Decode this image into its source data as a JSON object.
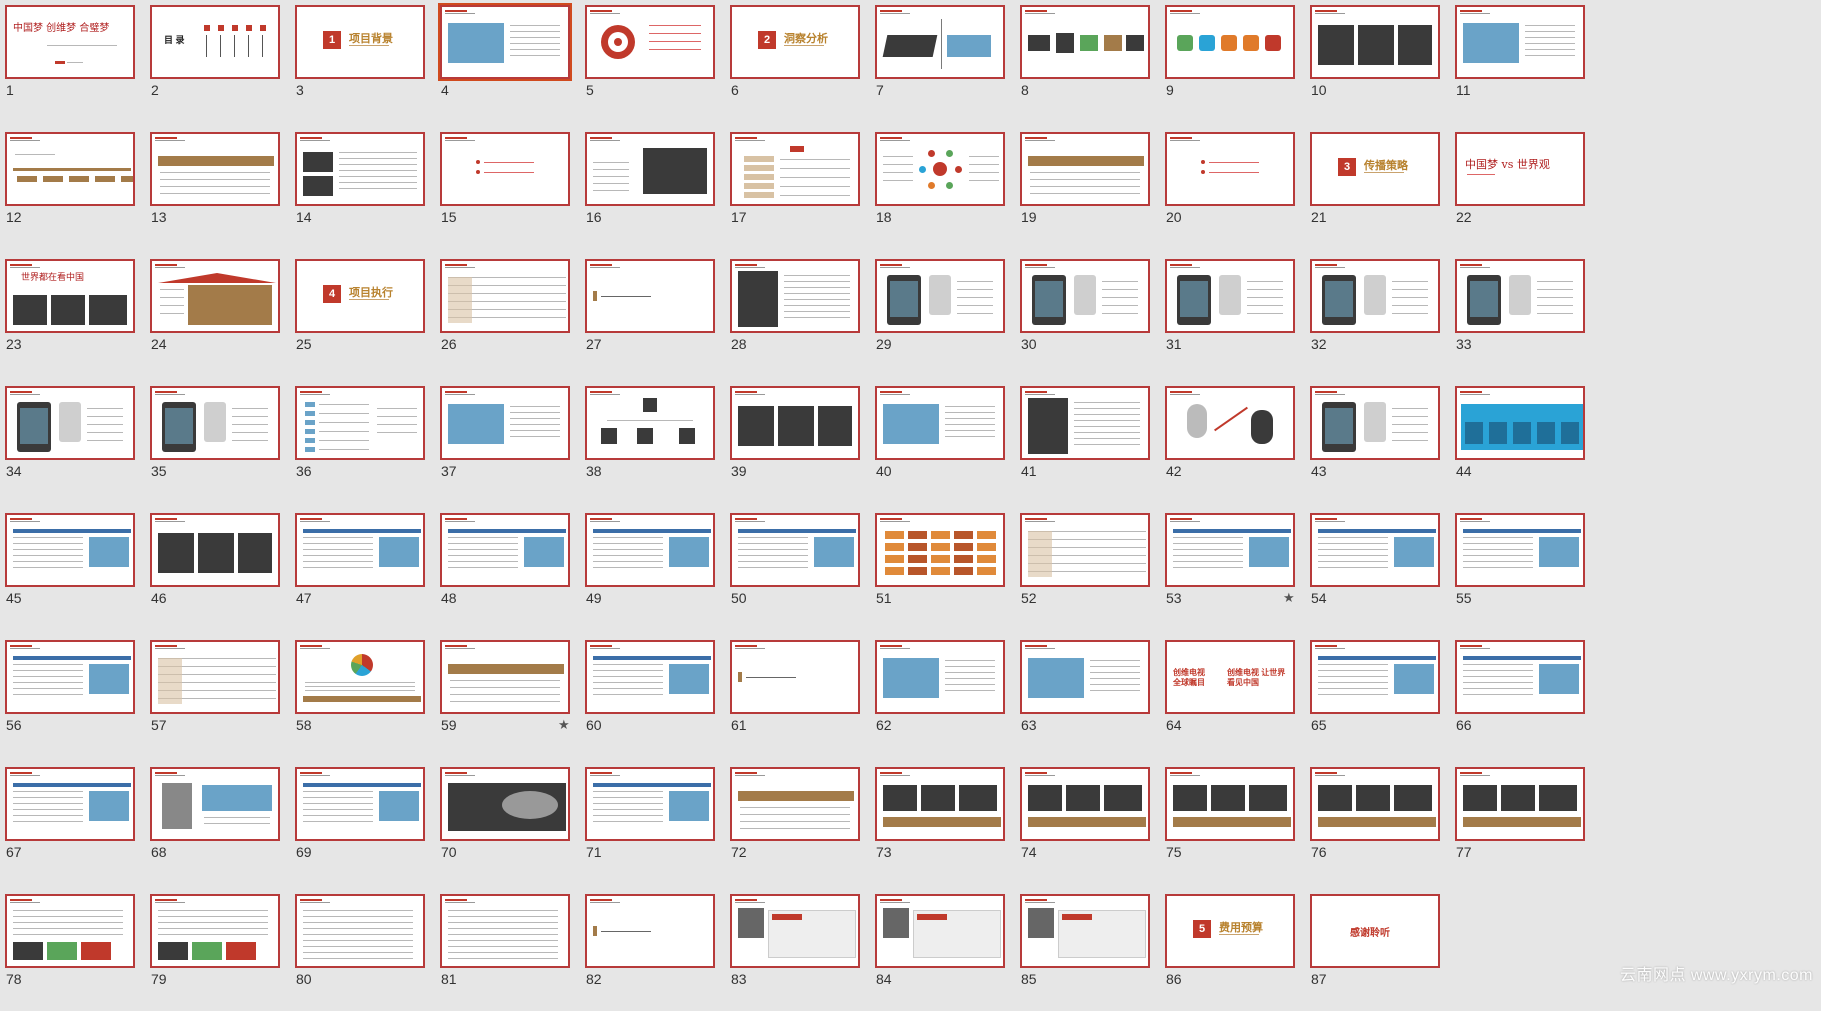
{
  "view": "slide-sorter",
  "accent_color": "#b73a3a",
  "selected_slide": 4,
  "watermark": "云南网点   www.yxrym.com",
  "slides": [
    {
      "number": "1",
      "type": "cover",
      "title_text": "中国梦 创维梦 合璧梦"
    },
    {
      "number": "2",
      "type": "toc",
      "title_text": "目 录"
    },
    {
      "number": "3",
      "type": "section",
      "section_no": "1",
      "section_title": "项目背景"
    },
    {
      "number": "4",
      "type": "photo-text"
    },
    {
      "number": "5",
      "type": "target"
    },
    {
      "number": "6",
      "type": "section",
      "section_no": "2",
      "section_title": "洞察分析"
    },
    {
      "number": "7",
      "type": "tv"
    },
    {
      "number": "8",
      "type": "products"
    },
    {
      "number": "9",
      "type": "app-icons"
    },
    {
      "number": "10",
      "type": "photo-grid"
    },
    {
      "number": "11",
      "type": "photo-text"
    },
    {
      "number": "12",
      "type": "timeline"
    },
    {
      "number": "13",
      "type": "banner-text"
    },
    {
      "number": "14",
      "type": "photo-list"
    },
    {
      "number": "15",
      "type": "bullets"
    },
    {
      "number": "16",
      "type": "tv-spec"
    },
    {
      "number": "17",
      "type": "vs-table"
    },
    {
      "number": "18",
      "type": "diagram"
    },
    {
      "number": "19",
      "type": "banner-text"
    },
    {
      "number": "20",
      "type": "bullets"
    },
    {
      "number": "21",
      "type": "section",
      "section_no": "3",
      "section_title": "传播策略"
    },
    {
      "number": "22",
      "type": "calig",
      "title_text": "中国梦 vs 世界观"
    },
    {
      "number": "23",
      "type": "calig-photos",
      "title_text": "世界都在看中国"
    },
    {
      "number": "24",
      "type": "house"
    },
    {
      "number": "25",
      "type": "section",
      "section_no": "4",
      "section_title": "项目执行"
    },
    {
      "number": "26",
      "type": "table"
    },
    {
      "number": "27",
      "type": "stage"
    },
    {
      "number": "28",
      "type": "poster"
    },
    {
      "number": "29",
      "type": "phones"
    },
    {
      "number": "30",
      "type": "phones"
    },
    {
      "number": "31",
      "type": "phones"
    },
    {
      "number": "32",
      "type": "phones"
    },
    {
      "number": "33",
      "type": "phones"
    },
    {
      "number": "34",
      "type": "phones"
    },
    {
      "number": "35",
      "type": "phones"
    },
    {
      "number": "36",
      "type": "list"
    },
    {
      "number": "37",
      "type": "photo-text"
    },
    {
      "number": "38",
      "type": "tree"
    },
    {
      "number": "39",
      "type": "photo-grid"
    },
    {
      "number": "40",
      "type": "photo-text"
    },
    {
      "number": "41",
      "type": "poster"
    },
    {
      "number": "42",
      "type": "versus"
    },
    {
      "number": "43",
      "type": "phones"
    },
    {
      "number": "44",
      "type": "blue-panels"
    },
    {
      "number": "45",
      "type": "web"
    },
    {
      "number": "46",
      "type": "photo-grid"
    },
    {
      "number": "47",
      "type": "web"
    },
    {
      "number": "48",
      "type": "web"
    },
    {
      "number": "49",
      "type": "web"
    },
    {
      "number": "50",
      "type": "web"
    },
    {
      "number": "51",
      "type": "orange-grid"
    },
    {
      "number": "52",
      "type": "table"
    },
    {
      "number": "53",
      "type": "web",
      "starred": "★"
    },
    {
      "number": "54",
      "type": "web"
    },
    {
      "number": "55",
      "type": "web"
    },
    {
      "number": "56",
      "type": "web"
    },
    {
      "number": "57",
      "type": "table"
    },
    {
      "number": "58",
      "type": "pie"
    },
    {
      "number": "59",
      "type": "banner-text",
      "starred": "★"
    },
    {
      "number": "60",
      "type": "web"
    },
    {
      "number": "61",
      "type": "stage"
    },
    {
      "number": "62",
      "type": "photo-text"
    },
    {
      "number": "63",
      "type": "photo-text"
    },
    {
      "number": "64",
      "type": "slogan",
      "left_text": "创维电视 全球瞩目",
      "right_text": "创维电视 让世界看见中国"
    },
    {
      "number": "65",
      "type": "web"
    },
    {
      "number": "66",
      "type": "web"
    },
    {
      "number": "67",
      "type": "web"
    },
    {
      "number": "68",
      "type": "portrait"
    },
    {
      "number": "69",
      "type": "web"
    },
    {
      "number": "70",
      "type": "dark-photo"
    },
    {
      "number": "71",
      "type": "web"
    },
    {
      "number": "72",
      "type": "banner-text"
    },
    {
      "number": "73",
      "type": "photo-strip"
    },
    {
      "number": "74",
      "type": "photo-strip"
    },
    {
      "number": "75",
      "type": "photo-strip"
    },
    {
      "number": "76",
      "type": "photo-strip"
    },
    {
      "number": "77",
      "type": "photo-strip"
    },
    {
      "number": "78",
      "type": "text-photos"
    },
    {
      "number": "79",
      "type": "text-photos"
    },
    {
      "number": "80",
      "type": "text"
    },
    {
      "number": "81",
      "type": "text"
    },
    {
      "number": "82",
      "type": "stage"
    },
    {
      "number": "83",
      "type": "portrait-web"
    },
    {
      "number": "84",
      "type": "portrait-web"
    },
    {
      "number": "85",
      "type": "portrait-web"
    },
    {
      "number": "86",
      "type": "section",
      "section_no": "5",
      "section_title": "费用预算"
    },
    {
      "number": "87",
      "type": "thanks",
      "title_text": "感谢聆听"
    }
  ]
}
